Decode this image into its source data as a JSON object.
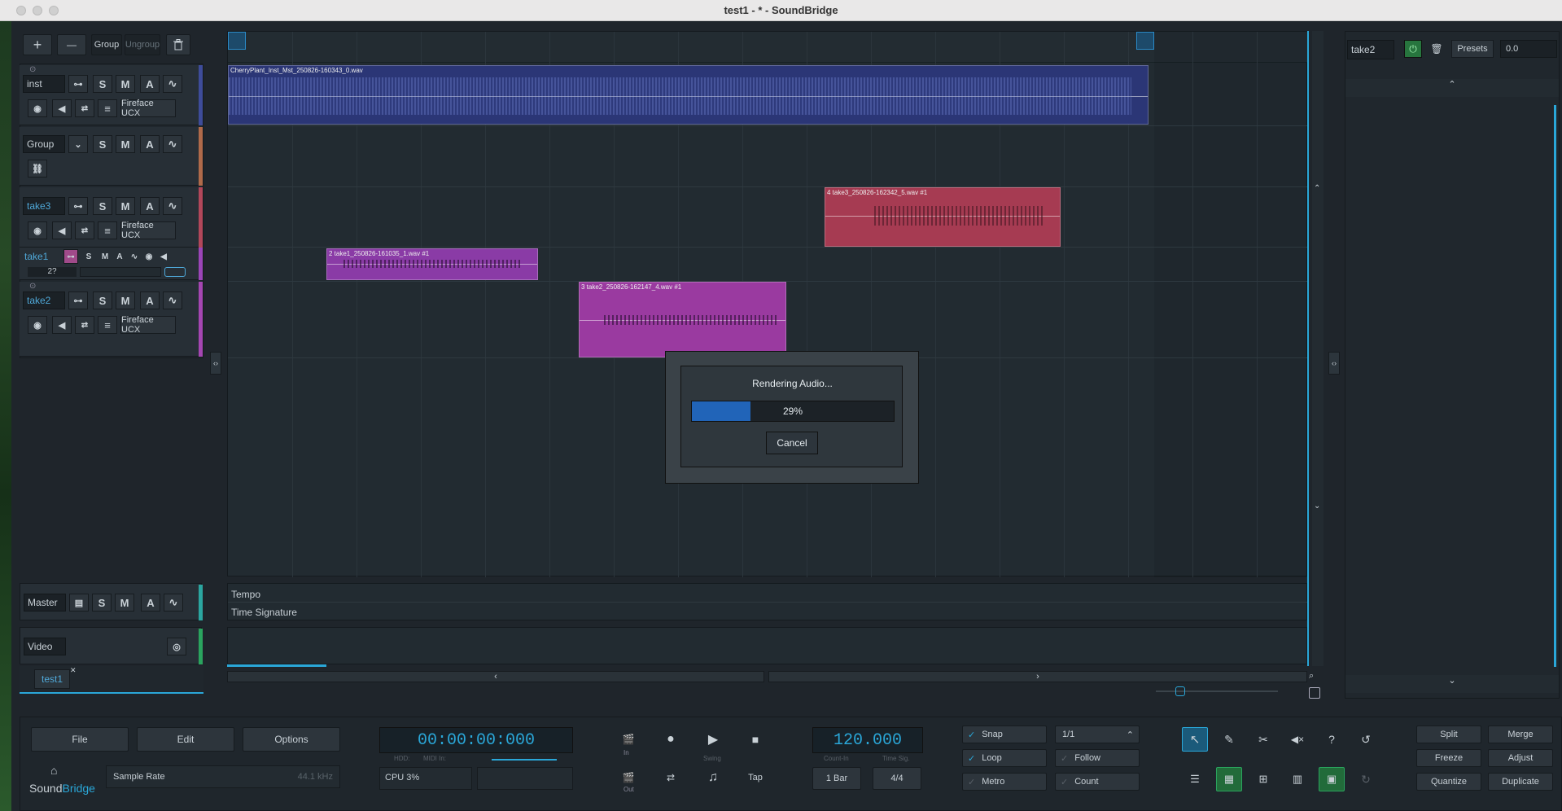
{
  "window": {
    "title": "test1 - * - SoundBridge"
  },
  "toolbar": {
    "add": "+",
    "remove": "—",
    "group": "Group",
    "ungroup": "Ungroup"
  },
  "tracks": [
    {
      "name": "inst",
      "s": "S",
      "m": "M",
      "a": "A",
      "output": "Fireface UCX",
      "color": "#3e4c9a"
    },
    {
      "name": "Group",
      "s": "S",
      "m": "M",
      "a": "A",
      "color": "#b06a4a"
    },
    {
      "name": "take3",
      "s": "S",
      "m": "M",
      "a": "A",
      "output": "Fireface UCX",
      "color": "#b2475a"
    },
    {
      "name": "take1",
      "s": "S",
      "m": "M",
      "a": "A",
      "num": "2?",
      "color": "#9b45b8"
    },
    {
      "name": "take2",
      "s": "S",
      "m": "M",
      "a": "A",
      "output": "Fireface UCX",
      "color": "#a546b2"
    }
  ],
  "master": {
    "name": "Master",
    "s": "S",
    "m": "M",
    "a": "A"
  },
  "video": {
    "name": "Video"
  },
  "tab": {
    "label": "test1"
  },
  "clips": [
    {
      "label": "CherryPlant_Inst_Mst_250826-160343_0.wav",
      "color": "#2b3676"
    },
    {
      "label": "4 take3_250826-162342_5.wav #1",
      "color": "#a63b52"
    },
    {
      "label": "2 take1_250826-161035_1.wav #1",
      "color": "#8a3ba6"
    },
    {
      "label": "3 take2_250826-162147_4.wav #1",
      "color": "#9a3aa0"
    }
  ],
  "lanes": {
    "tempo": "Tempo",
    "timesig": "Time Signature"
  },
  "dialog": {
    "title": "Rendering Audio...",
    "progress_text": "29%",
    "progress": 0.29,
    "cancel": "Cancel"
  },
  "inspector": {
    "name": "take2",
    "presets": "Presets",
    "value": "0.0"
  },
  "transport": {
    "file": "File",
    "edit": "Edit",
    "options": "Options",
    "sample_rate_label": "Sample Rate",
    "sample_rate": "44.1 kHz",
    "logo_a": "Sound",
    "logo_b": "Bridge",
    "time": "00:00:00:000",
    "cpu": "CPU 3%",
    "hdd": "HDD:",
    "midi_in": "MIDI In:",
    "in": "In",
    "out": "Out",
    "swing": "Swing",
    "tap": "Tap",
    "tempo": "120.000",
    "count_in": "Count-In",
    "count_in_val": "1 Bar",
    "time_sig": "Time Sig.",
    "time_sig_val": "4/4",
    "snap": "Snap",
    "loop": "Loop",
    "metro": "Metro",
    "follow": "Follow",
    "count": "Count",
    "grid": "1/1",
    "split": "Split",
    "merge": "Merge",
    "freeze": "Freeze",
    "adjust": "Adjust",
    "quantize": "Quantize",
    "duplicate": "Duplicate"
  }
}
